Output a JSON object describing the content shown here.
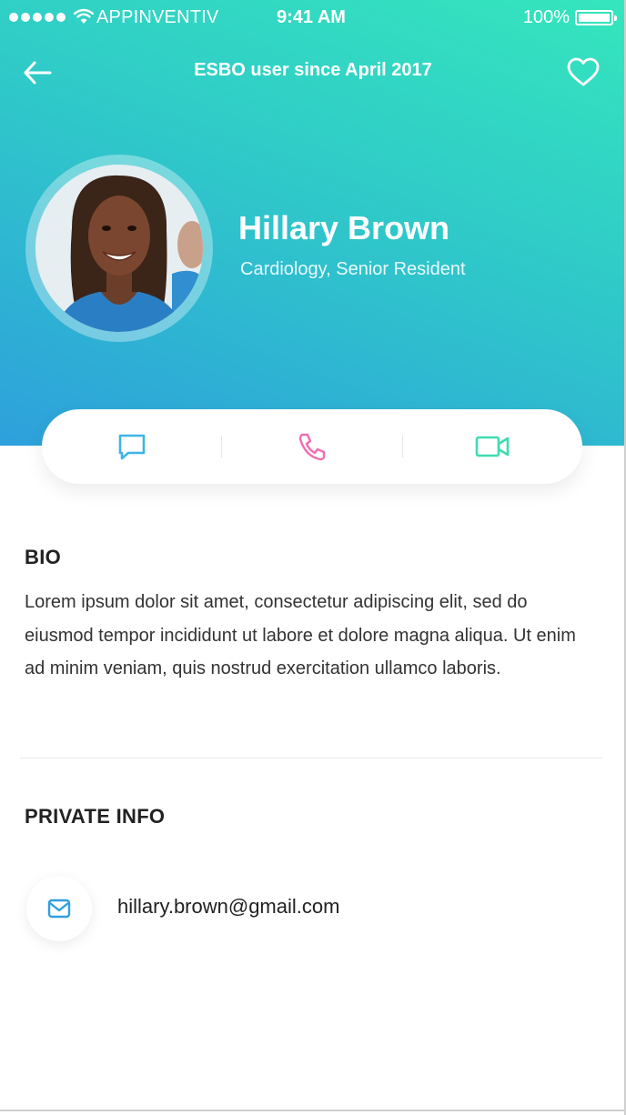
{
  "status_bar": {
    "carrier": "APPINVENTIV",
    "time": "9:41 AM",
    "battery": "100%"
  },
  "nav": {
    "title": "ESBO user since April 2017",
    "back_icon": "arrow-left-icon",
    "favorite_icon": "heart-icon"
  },
  "profile": {
    "name": "Hillary Brown",
    "role": "Cardiology, Senior Resident"
  },
  "actions": [
    {
      "icon": "chat-icon",
      "color": "#3cb6e3"
    },
    {
      "icon": "phone-icon",
      "color": "#f06fb0"
    },
    {
      "icon": "video-icon",
      "color": "#3fdcb0"
    }
  ],
  "bio": {
    "title": "BIO",
    "text": "Lorem ipsum dolor sit amet, consectetur adipiscing elit, sed do eiusmod tempor incididunt ut labore et dolore magna aliqua. Ut enim ad minim veniam, quis nostrud exercitation ullamco laboris."
  },
  "private_info": {
    "title": "PRIVATE INFO",
    "email": "hillary.brown@gmail.com",
    "email_icon": "mail-icon"
  },
  "colors": {
    "gradient_top": "#35e6bd",
    "gradient_bottom": "#2ea0dc"
  }
}
